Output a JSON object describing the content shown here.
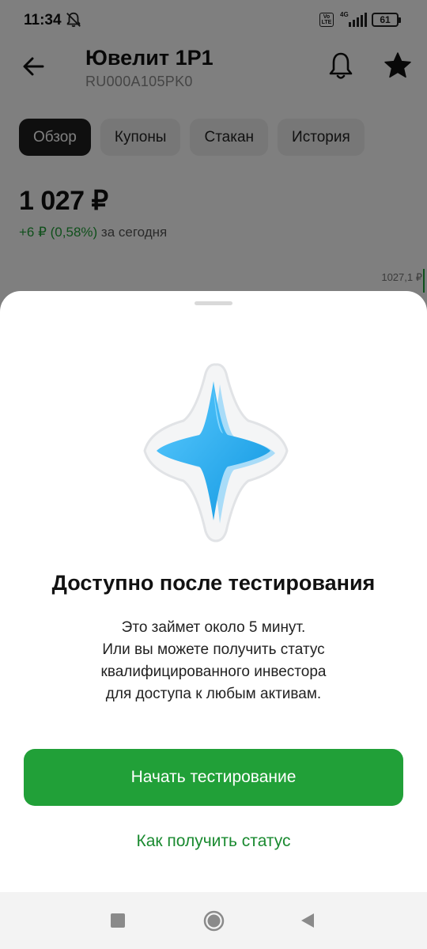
{
  "status_bar": {
    "time": "11:34",
    "volte": "Vo LTE",
    "network": "4G",
    "battery": "61"
  },
  "header": {
    "title": "Ювелит 1Р1",
    "isin": "RU000A105PK0",
    "icons": [
      "back-icon",
      "bell-icon",
      "star-icon"
    ]
  },
  "tabs": [
    {
      "label": "Обзор",
      "active": true
    },
    {
      "label": "Купоны",
      "active": false
    },
    {
      "label": "Стакан",
      "active": false
    },
    {
      "label": "История",
      "active": false
    }
  ],
  "quote": {
    "price": "1 027 ₽",
    "change": "+6 ₽ (0,58%)",
    "change_suffix": " за сегодня",
    "chart_last_label": "1027,1 ₽"
  },
  "sheet": {
    "title": "Доступно после тестирования",
    "description_lines": [
      "Это займет около 5 минут.",
      "Или вы можете получить статус",
      "квалифицированного инвестора",
      "для доступа к любым активам."
    ],
    "primary_button": "Начать тестирование",
    "link_button": "Как получить статус"
  },
  "colors": {
    "accent_green": "#21a038",
    "sparkle_blue": "#1fa3ea"
  }
}
